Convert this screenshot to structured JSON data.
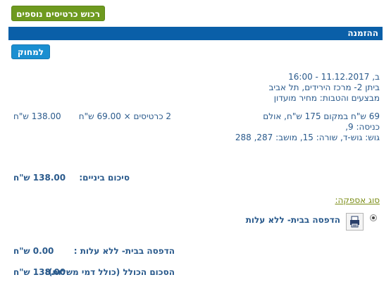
{
  "buttons": {
    "buy_more": "רכוש כרטיסים נוספים",
    "delete": "למחוק"
  },
  "header": {
    "title": "ההזמנה"
  },
  "event": {
    "datetime": "ב, 11.12.2017 - 16:00",
    "venue": "ביתן 2- מרכז הירידים, תל אביב",
    "promo": "מבצעים והטבות: מחיר מועדון"
  },
  "ticket": {
    "description": "69 ש\"ח במקום 175 ש\"ח, אולם",
    "entrance": "כניסה: 9,",
    "seats": "גוש: גוש-ד, שורה: 15, מושב: 287, 288",
    "quantity": "2 כרטיסים × 69.00 ש\"ח",
    "line_total": "138.00 ש\"ח"
  },
  "subtotal": {
    "label": "סיכום ביניים:",
    "value": "138.00 ש\"ח"
  },
  "delivery": {
    "section_label": "סוג אספקה:",
    "option_label": "הדפסה בבית- ללא עלות",
    "option_icon": "printer-icon",
    "selected": true
  },
  "summary": {
    "delivery_label": "הדפסה בבית- ללא עלות :",
    "delivery_value": "0.00 ש\"ח",
    "total_label": "הסכום הכולל (כולל דמי משלוח):",
    "total_value": "138.00 ש\"ח"
  }
}
